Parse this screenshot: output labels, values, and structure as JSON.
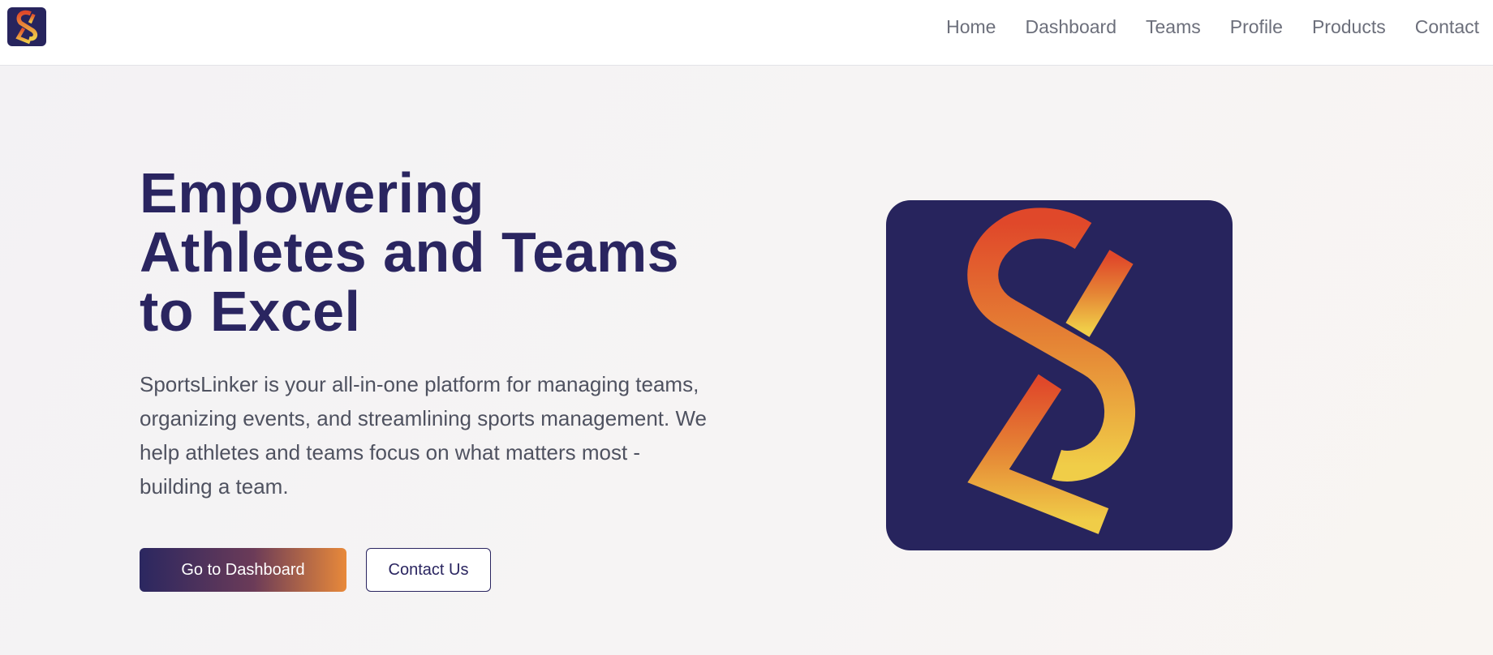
{
  "nav": {
    "items": [
      {
        "label": "Home"
      },
      {
        "label": "Dashboard"
      },
      {
        "label": "Teams"
      },
      {
        "label": "Profile"
      },
      {
        "label": "Products"
      },
      {
        "label": "Contact"
      }
    ]
  },
  "hero": {
    "title": "Empowering Athletes and Teams to Excel",
    "description": "SportsLinker is your all-in-one platform for managing teams, organizing events, and streamlining sports management. We help athletes and teams focus on what matters most - building a team.",
    "primary_button": "Go to Dashboard",
    "secondary_button": "Contact Us"
  },
  "brand": {
    "logo_icon": "sportslinker-s-logo",
    "logo_bg": "#27245d",
    "gradient_top": "#e0482a",
    "gradient_bottom": "#f0cd48"
  },
  "colors": {
    "primary_text": "#2a2560",
    "nav_text": "#6c6f7b",
    "button_gradient_start": "#2b2760",
    "button_gradient_end": "#e8893a"
  }
}
